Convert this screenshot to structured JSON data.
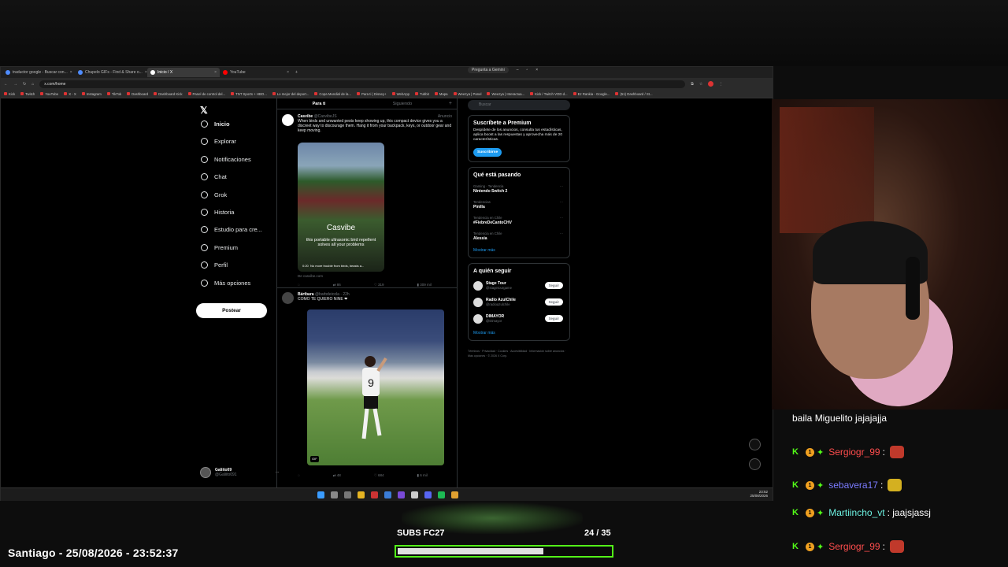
{
  "browser": {
    "tabs": [
      {
        "label": "traductor google - Buscar con..."
      },
      {
        "label": "Chupelo GIFs - Find & Share o..."
      },
      {
        "label": "Inicio / X"
      },
      {
        "label": "YouTube"
      }
    ],
    "gemini": "Pregunta a Gemini",
    "url": "x.com/home",
    "bookmarks": [
      "Kick",
      "Twitch",
      "YouTube",
      "X - X",
      "Instagram",
      "TikTok",
      "Dashboard",
      "Dashboard Kick",
      "Panel de control del...",
      "TNT Sports + HBO...",
      "Lo mejor del deport...",
      "Copa Mundial de la...",
      "Para ti | Disney+",
      "WebApp",
      "Tubbit",
      "Mapa",
      "Weezya | Panel",
      "Weezya | Interactua...",
      "Kick / Twitch VOD d...",
      "Ez Rankia - Google...",
      "(51) Dashboard / St..."
    ]
  },
  "x": {
    "nav": [
      "Inicio",
      "Explorar",
      "Notificaciones",
      "Chat",
      "Grok",
      "Historia",
      "Estudio para cre...",
      "Premium",
      "Perfil",
      "Más opciones"
    ],
    "post_button": "Postear",
    "user_name": "Galiito09",
    "user_handle": "@Galiito091",
    "feed_tabs": [
      "Para ti",
      "Siguiendo"
    ],
    "tweet1": {
      "name": "Casvibe",
      "handle": "@CasvibeJS",
      "tag": "Anuncio",
      "text": "When birds and unwanted pests keep showing up, this compact device gives you a discreet way to discourage them. Hang it from your backpack, keys, or outdoor gear and keep moving.",
      "brand": "Casvibe",
      "caption": "this portable ultrasonic bird repellent solves all your problems",
      "video_time": "0:20",
      "video_text": "No more trouble from birds, beasts a...",
      "source": "De casvibe.com",
      "stats": [
        "",
        "86",
        "319",
        "309 mil"
      ]
    },
    "tweet2": {
      "name": "Bártbara",
      "handle": "@barbdeicola · 22h",
      "text": "COMO TE QUIERO NINE ❤",
      "gif": "GIF",
      "stats": [
        "",
        "48",
        "684",
        "6 mil"
      ]
    },
    "search_placeholder": "Buscar",
    "premium": {
      "title": "Suscríbete a Premium",
      "text": "Despídete de los anuncios, consulta tus estadísticas, aplica boost a las respuestas y aprovecha más de 20 características.",
      "button": "Suscribirse"
    },
    "trends_title": "Qué está pasando",
    "trends": [
      {
        "cat": "Gaming · Tendencia",
        "name": "Nintendo Switch 2"
      },
      {
        "cat": "Tendencias",
        "name": "Pinilla"
      },
      {
        "cat": "Tendencia en Chile",
        "name": "#FiebreDeCantoCHV"
      },
      {
        "cat": "Tendencia en Chile",
        "name": "Alessia"
      }
    ],
    "show_more": "Mostrar más",
    "follow_title": "A quién seguir",
    "follow": [
      {
        "name": "Stage Tour",
        "handle": "@stagetourgame"
      },
      {
        "name": "Radio AzulChile",
        "handle": "@radioazulchile"
      },
      {
        "name": "DIMAYOR",
        "handle": "@Dimayor"
      }
    ],
    "follow_button": "Seguir",
    "footer": "Términos · Privacidad · Cookies · Accesibilidad · Información sobre anuncios · Más opciones · © 2026 X Corp."
  },
  "taskbar": {
    "time": "23:52",
    "date": "25/08/2026"
  },
  "chat": [
    {
      "user": "",
      "text": "baila Miguelito jajajajja",
      "color": "#ffffff"
    },
    {
      "user": "Sergiogr_99",
      "text": ":",
      "color": "#ff4d4d"
    },
    {
      "user": "sebavera17",
      "text": ":",
      "color": "#7b7bff"
    },
    {
      "user": "Martiincho_vt",
      "text": ": jaajsjassj",
      "color": "#6cf0e0"
    },
    {
      "user": "Sergiogr_99",
      "text": ":",
      "color": "#ff4d4d"
    }
  ],
  "overlay": {
    "location": "Santiago - 25/08/2026 - 23:52:37",
    "subs_label": "SUBS FC27",
    "subs_count": "24 / 35",
    "subs_progress": 0.686
  },
  "colors": {
    "accent": "#1d9bf0",
    "kick_green": "#53fc18"
  }
}
